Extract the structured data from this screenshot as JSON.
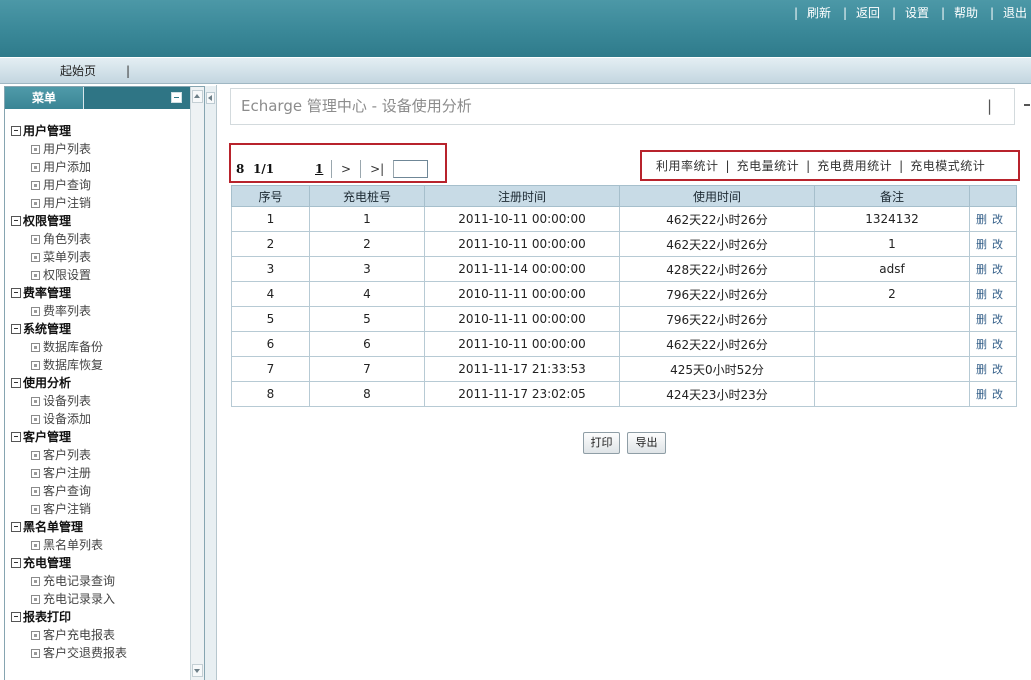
{
  "colors": {
    "header_bg": "#3a8898",
    "accent_teal": "#2f7585",
    "highlight_red": "#b8232c",
    "table_header_bg": "#c8dbe6",
    "link_blue": "#35608a"
  },
  "header": {
    "separator": "|",
    "nav": [
      "刷新",
      "返回",
      "设置",
      "帮助",
      "退出"
    ]
  },
  "tabs": {
    "home": "起始页",
    "separator": "|"
  },
  "sidebar": {
    "title": "菜单",
    "groups": [
      {
        "label": "用户管理",
        "items": [
          "用户列表",
          "用户添加",
          "用户查询",
          "用户注销"
        ]
      },
      {
        "label": "权限管理",
        "items": [
          "角色列表",
          "菜单列表",
          "权限设置"
        ]
      },
      {
        "label": "费率管理",
        "items": [
          "费率列表"
        ]
      },
      {
        "label": "系统管理",
        "items": [
          "数据库备份",
          "数据库恢复"
        ]
      },
      {
        "label": "使用分析",
        "items": [
          "设备列表",
          "设备添加"
        ]
      },
      {
        "label": "客户管理",
        "items": [
          "客户列表",
          "客户注册",
          "客户查询",
          "客户注销"
        ]
      },
      {
        "label": "黑名单管理",
        "items": [
          "黑名单列表"
        ]
      },
      {
        "label": "充电管理",
        "items": [
          "充电记录查询",
          "充电记录录入"
        ]
      },
      {
        "label": "报表打印",
        "items": [
          "客户充电报表",
          "客户交退费报表"
        ]
      }
    ]
  },
  "main": {
    "title": "Echarge 管理中心 - 设备使用分析",
    "title_separator": "|",
    "pager": {
      "total": "8",
      "page_of": "1/1",
      "current_page": "1",
      "next": ">",
      "last": ">|",
      "goto_value": ""
    },
    "stats": {
      "separator": "|",
      "links": [
        "利用率统计",
        "充电量统计",
        "充电费用统计",
        "充电模式统计"
      ]
    },
    "table": {
      "columns": [
        "序号",
        "充电桩号",
        "注册时间",
        "使用时间",
        "备注"
      ],
      "rows": [
        {
          "no": "1",
          "pile": "1",
          "registered": "2011-10-11 00:00:00",
          "usage": "462天22小时26分",
          "remark": "1324132"
        },
        {
          "no": "2",
          "pile": "2",
          "registered": "2011-10-11 00:00:00",
          "usage": "462天22小时26分",
          "remark": "1"
        },
        {
          "no": "3",
          "pile": "3",
          "registered": "2011-11-14 00:00:00",
          "usage": "428天22小时26分",
          "remark": "adsf"
        },
        {
          "no": "4",
          "pile": "4",
          "registered": "2010-11-11 00:00:00",
          "usage": "796天22小时26分",
          "remark": "2"
        },
        {
          "no": "5",
          "pile": "5",
          "registered": "2010-11-11 00:00:00",
          "usage": "796天22小时26分",
          "remark": ""
        },
        {
          "no": "6",
          "pile": "6",
          "registered": "2011-10-11 00:00:00",
          "usage": "462天22小时26分",
          "remark": ""
        },
        {
          "no": "7",
          "pile": "7",
          "registered": "2011-11-17 21:33:53",
          "usage": "425天0小时52分",
          "remark": ""
        },
        {
          "no": "8",
          "pile": "8",
          "registered": "2011-11-17 23:02:05",
          "usage": "424天23小时23分",
          "remark": ""
        }
      ],
      "actions": {
        "delete": "删",
        "edit": "改"
      }
    },
    "buttons": {
      "print": "打印",
      "export": "导出"
    }
  }
}
